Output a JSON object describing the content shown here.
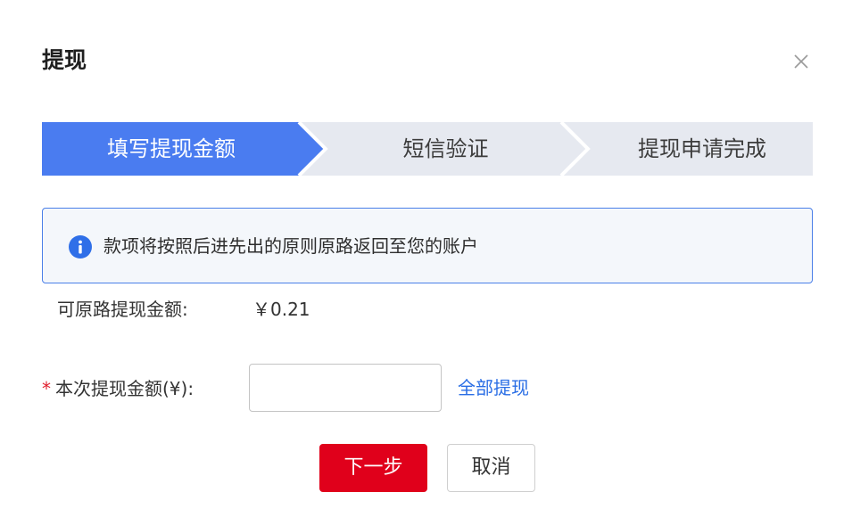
{
  "dialog": {
    "title": "提现"
  },
  "steps": [
    {
      "label": "填写提现金额",
      "active": true
    },
    {
      "label": "短信验证",
      "active": false
    },
    {
      "label": "提现申请完成",
      "active": false
    }
  ],
  "info": {
    "text": "款项将按照后进先出的原则原路返回至您的账户"
  },
  "available": {
    "label": "可原路提现金额:",
    "value": "￥0.21"
  },
  "amount": {
    "required_mark": "*",
    "label": "本次提现金额(¥):",
    "value": "",
    "placeholder": "",
    "withdraw_all_label": "全部提现"
  },
  "actions": {
    "next_label": "下一步",
    "cancel_label": "取消"
  },
  "colors": {
    "accent_blue": "#4a7cf0",
    "step_bg": "#e6e9f0",
    "primary_red": "#e0001b",
    "link_blue": "#2a6ee5",
    "required_red": "#e0202e"
  },
  "icons": {
    "close": "close-icon",
    "info": "info-circle-icon"
  }
}
